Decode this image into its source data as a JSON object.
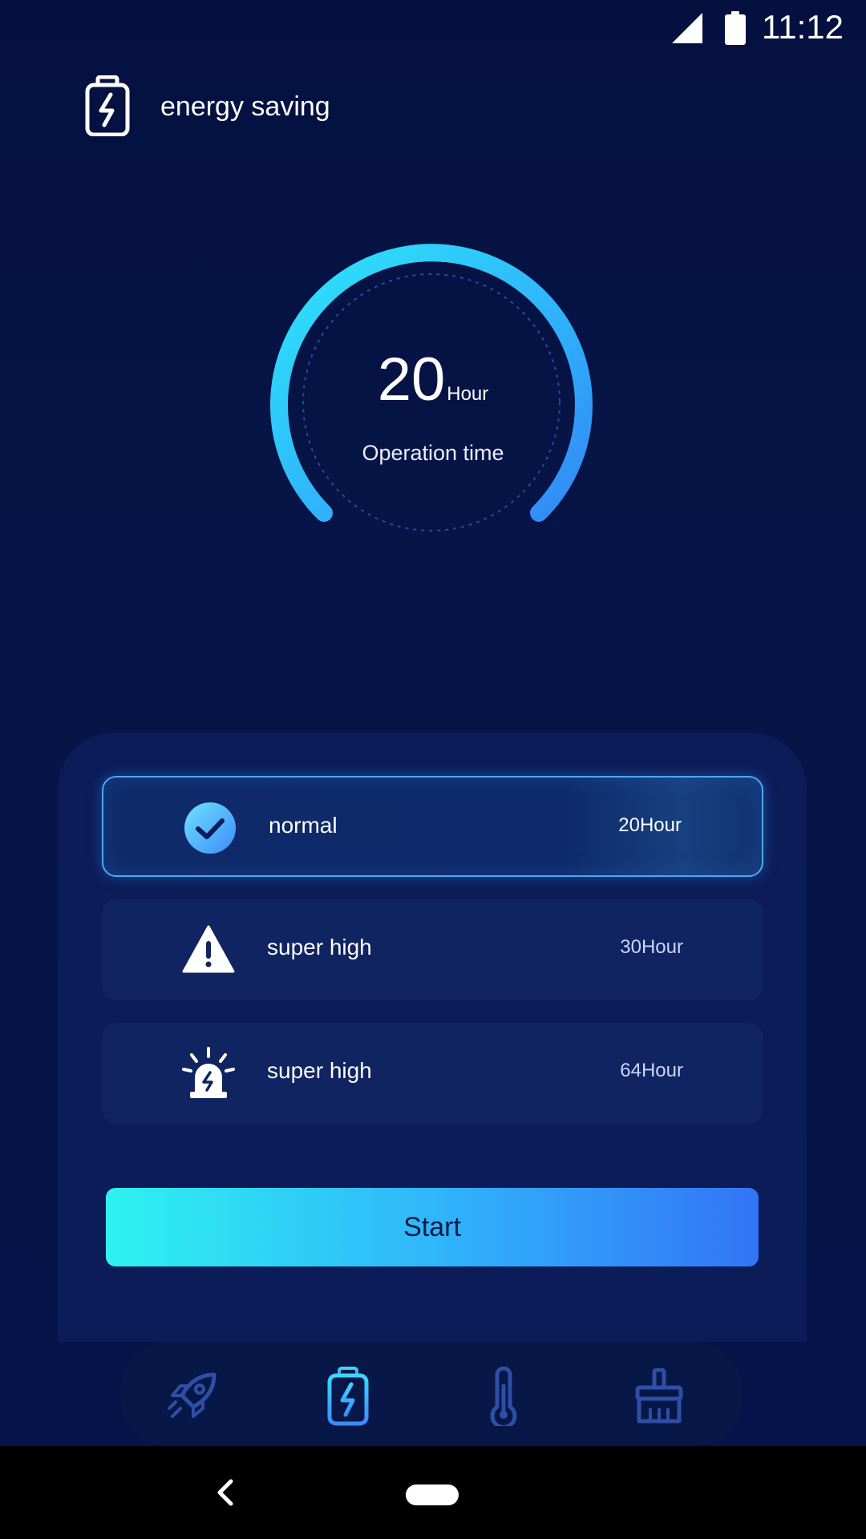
{
  "status_bar": {
    "time": "11:12",
    "icons": [
      "signal-icon",
      "battery-icon"
    ]
  },
  "header": {
    "title": "energy saving",
    "icon": "battery-bolt-icon"
  },
  "gauge": {
    "value": "20",
    "unit": "Hour",
    "caption": "Operation time"
  },
  "modes": [
    {
      "label": "normal",
      "hours": "20Hour",
      "icon": "check-circle-icon",
      "selected": true
    },
    {
      "label": "super high",
      "hours": "30Hour",
      "icon": "warning-triangle-icon",
      "selected": false
    },
    {
      "label": "super high",
      "hours": "64Hour",
      "icon": "alarm-siren-icon",
      "selected": false
    }
  ],
  "start_button": {
    "label": "Start"
  },
  "bottom_nav": {
    "items": [
      {
        "icon": "rocket-icon",
        "active": false
      },
      {
        "icon": "battery-bolt-icon",
        "active": true
      },
      {
        "icon": "thermometer-icon",
        "active": false
      },
      {
        "icon": "broom-icon",
        "active": false
      }
    ]
  },
  "colors": {
    "background": "#041240",
    "panel": "#0b1c58",
    "accent_start": "#2ef2f0",
    "accent_end": "#3374f7",
    "nav_icon": "#2e4fa6"
  }
}
